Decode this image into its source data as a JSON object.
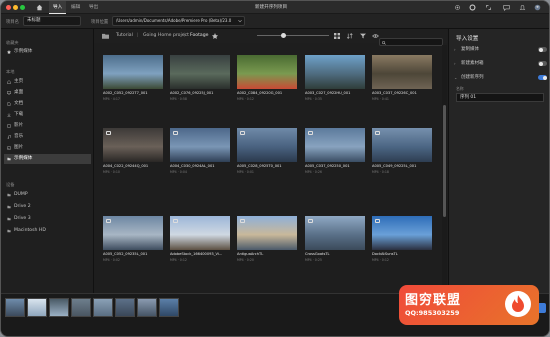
{
  "titlebar": {
    "tabs": [
      {
        "label": "导入",
        "active": true
      },
      {
        "label": "编辑",
        "active": false
      },
      {
        "label": "导出",
        "active": false
      }
    ],
    "window_title": "新建开序列项目",
    "colors": {
      "close": "#ff5f57",
      "minimize": "#febc2e",
      "maximize": "#28c840"
    }
  },
  "project": {
    "name_label": "项目名",
    "name_value": "未标题",
    "location_label": "项目位置",
    "location_value": "/Users/admin/Documents/Adobe/Premiere Pro (Beta)/23.0"
  },
  "sidebar": {
    "recent_section": "收藏夹",
    "favorite": "示例媒体",
    "local_section": "本地",
    "items": [
      {
        "label": "主页",
        "icon": "home-icon"
      },
      {
        "label": "桌面",
        "icon": "desktop-icon"
      },
      {
        "label": "文档",
        "icon": "document-icon"
      },
      {
        "label": "下载",
        "icon": "download-icon"
      },
      {
        "label": "影片",
        "icon": "film-icon"
      },
      {
        "label": "音乐",
        "icon": "music-icon"
      },
      {
        "label": "图片",
        "icon": "image-icon"
      },
      {
        "label": "示例媒体",
        "icon": "folder-icon",
        "selected": true
      }
    ],
    "devices_section": "设备",
    "devices": [
      {
        "label": "DUMP"
      },
      {
        "label": "Drive 2"
      },
      {
        "label": "Drive 3"
      },
      {
        "label": "Macintosh HD"
      }
    ]
  },
  "breadcrumb": {
    "items": [
      "Tutorial",
      "Going Home project",
      "Footage"
    ]
  },
  "grid": {
    "tiles": [
      {
        "name": "A002_C052_0922T7_001",
        "meta": "MP4 · 4:17",
        "colors": [
          "#4d6e8c",
          "#7fa1bf",
          "#3c4a35"
        ]
      },
      {
        "name": "A002_C076_09225J_001",
        "meta": "MP4 · 0:58",
        "colors": [
          "#384040",
          "#5a6a5c",
          "#2a2f2c"
        ]
      },
      {
        "name": "A002_C084_09220G_001",
        "meta": "MP4 · 0:12",
        "colors": [
          "#4a6b32",
          "#7a9a50",
          "#c94a35"
        ]
      },
      {
        "name": "A003_C027_0922HU_001",
        "meta": "MP4 · 0:35",
        "colors": [
          "#6ea1c9",
          "#4f6c80",
          "#2f3d3a"
        ]
      },
      {
        "name": "A003_C037_09226C_001",
        "meta": "MP4 · 0:41",
        "colors": [
          "#8a7a62",
          "#4d4638",
          "#6f6454"
        ]
      },
      {
        "name": "A004_C022_09244Q_001",
        "meta": "MP4 · 0:10",
        "colors": [
          "#3d3a38",
          "#6a6058",
          "#2a2725"
        ]
      },
      {
        "name": "A004_C030_0924AL_001",
        "meta": "MP4 · 0:04",
        "colors": [
          "#4d688a",
          "#7a96b5",
          "#2f3f55"
        ]
      },
      {
        "name": "A005_C028_0925T0_001",
        "meta": "MP4 · 0:01",
        "colors": [
          "#6f8aa8",
          "#4a6280",
          "#2b3a4d"
        ]
      },
      {
        "name": "A005_C037_092250_001",
        "meta": "MP4 · 0:26",
        "colors": [
          "#5c7a9c",
          "#88a3bf",
          "#3a4d63"
        ]
      },
      {
        "name": "A005_C049_09225L_001",
        "meta": "MP4 · 0:18",
        "colors": [
          "#7690ad",
          "#4c6684",
          "#2e3e52"
        ]
      },
      {
        "name": "A005_C052_09235L_001",
        "meta": "MP4 · 0:02",
        "colors": [
          "#6d87a3",
          "#a8b6c4",
          "#3d4c5e"
        ]
      },
      {
        "name": "AdobeStock_166400093_Vi...",
        "meta": "MP4 · 0:12",
        "colors": [
          "#9cb6d8",
          "#cfd8e2",
          "#5c5042"
        ]
      },
      {
        "name": "AntiguaArchTL",
        "meta": "MP4 · 0:20",
        "colors": [
          "#8fb0d8",
          "#c9b89a",
          "#4b5a6a"
        ]
      },
      {
        "name": "CrossGoatsTL",
        "meta": "MP4 · 0:25",
        "colors": [
          "#8fa8c4",
          "#5a7088",
          "#3b4a5a"
        ]
      },
      {
        "name": "DockAtSunsTL",
        "meta": "MP4 · 0:12",
        "colors": [
          "#2e6db8",
          "#6aa0d8",
          "#2b3040"
        ]
      }
    ]
  },
  "import_settings": {
    "title": "导入设置",
    "rows": [
      {
        "label": "复制媒体",
        "on": false
      },
      {
        "label": "新建素材箱",
        "on": false
      },
      {
        "label": "创建新序列",
        "on": true
      }
    ],
    "sequence_name_label": "名称",
    "sequence_name_value": "序列 01"
  },
  "bottom": {
    "strip_colors": [
      [
        "#6e8cab",
        "#3c4a5c"
      ],
      [
        "#d9e4ee",
        "#8fa6bd"
      ],
      [
        "#4a5a66",
        "#9ab0c4"
      ],
      [
        "#6d7e8c",
        "#4a5662"
      ],
      [
        "#8aa0b6",
        "#5a6e82"
      ],
      [
        "#5c7088",
        "#3a4758"
      ],
      [
        "#8a9ab0",
        "#465566"
      ],
      [
        "#5b7fa8",
        "#2f4866"
      ]
    ]
  },
  "watermark": {
    "title": "图穷联盟",
    "qq": "QQ:985303259"
  }
}
